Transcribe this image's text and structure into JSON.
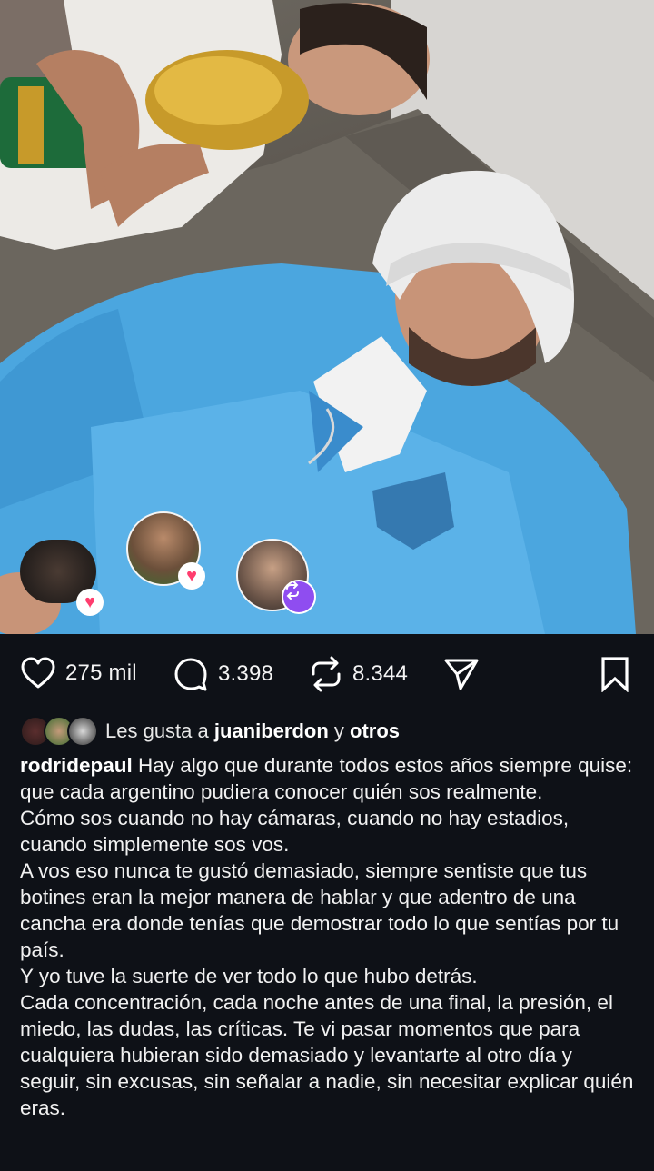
{
  "post": {
    "stats": {
      "likes": "275 mil",
      "comments": "3.398",
      "reposts": "8.344"
    },
    "icons": {
      "like": "heart-icon",
      "comment": "comment-bubble-icon",
      "repost": "repost-arrows-icon",
      "share": "paper-plane-icon",
      "save": "bookmark-icon",
      "story_heart": "heart-badge-icon",
      "story_repost": "repost-badge-icon"
    },
    "colors": {
      "background": "#0e1117",
      "text": "#f2f2f2",
      "heart_badge": "#ff3d6e",
      "repost_badge": "#8f4df0"
    },
    "liked_by": {
      "prefix": "Les gusta a",
      "user": "juaniberdon",
      "connector": "y",
      "others": "otros"
    },
    "caption": {
      "username": "rodridepaul",
      "paragraphs": [
        "Hay algo que durante todos estos años siempre quise: que cada argentino pudiera conocer quién sos realmente.",
        "Cómo sos cuando no hay cámaras, cuando no hay estadios, cuando simplemente sos vos.",
        "A vos eso nunca te gustó demasiado, siempre sentiste que tus botines eran la mejor manera de hablar y que adentro de una cancha era donde tenías que demostrar todo lo que sentías por tu país.",
        "Y yo tuve la suerte de ver todo lo que hubo detrás.",
        "Cada concentración, cada noche antes de una final, la presión, el miedo, las dudas, las críticas. Te vi pasar momentos que para cualquiera hubieran sido demasiado y levantarte al otro día y seguir, sin excusas, sin señalar a nadie, sin necesitar explicar quién eras."
      ]
    }
  }
}
